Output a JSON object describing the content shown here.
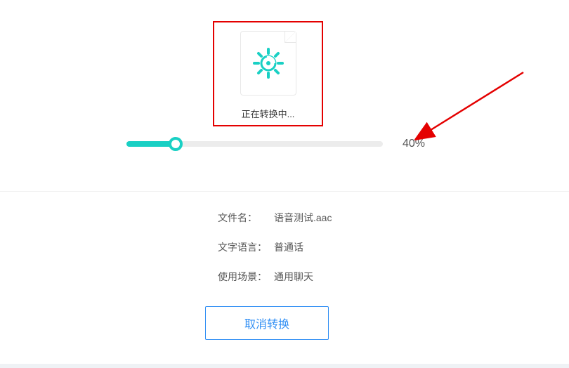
{
  "status": {
    "text": "正在转换中..."
  },
  "progress": {
    "percent": 40,
    "label": "40%"
  },
  "details": {
    "filename_label": "文件名：",
    "filename_value": "语音测试.aac",
    "language_label": "文字语言：",
    "language_value": "普通话",
    "scene_label": "使用场景：",
    "scene_value": "通用聊天"
  },
  "actions": {
    "cancel_label": "取消转换"
  },
  "colors": {
    "accent": "#19d0c4",
    "primary": "#2f8ef4",
    "annotation": "#e40000"
  }
}
